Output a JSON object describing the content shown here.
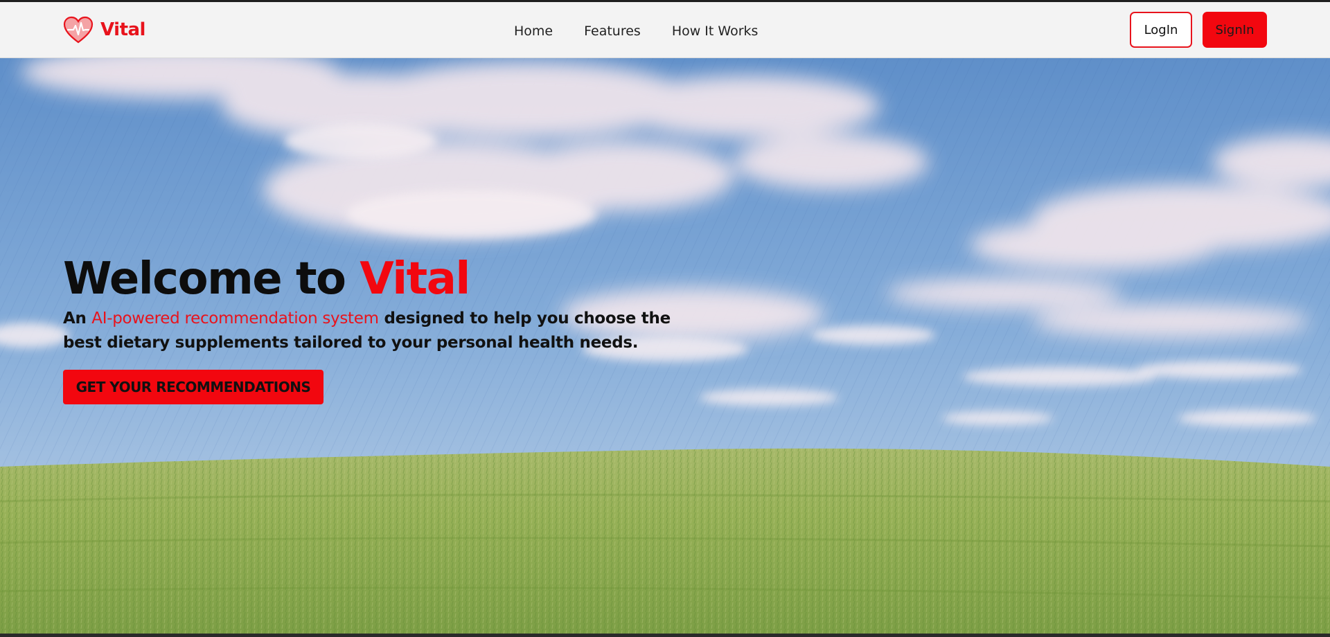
{
  "brand": {
    "name": "Vital",
    "icon": "heart-pulse-icon",
    "color": "#e8131c"
  },
  "nav": {
    "links": [
      "Home",
      "Features",
      "How It Works"
    ],
    "login_label": "LogIn",
    "signin_label": "SignIn"
  },
  "hero": {
    "title_prefix": "Welcome to ",
    "title_accent": "Vital",
    "subtitle_prefix": "An ",
    "subtitle_accent": "AI-powered recommendation system",
    "subtitle_suffix": " designed to help you choose the best dietary supplements tailored to your personal health needs.",
    "cta_label": "GET YOUR RECOMMENDATIONS",
    "background": "watercolor-sky-and-grass-field"
  },
  "colors": {
    "accent": "#f2070f",
    "navbar_bg": "#f3f3f3"
  }
}
